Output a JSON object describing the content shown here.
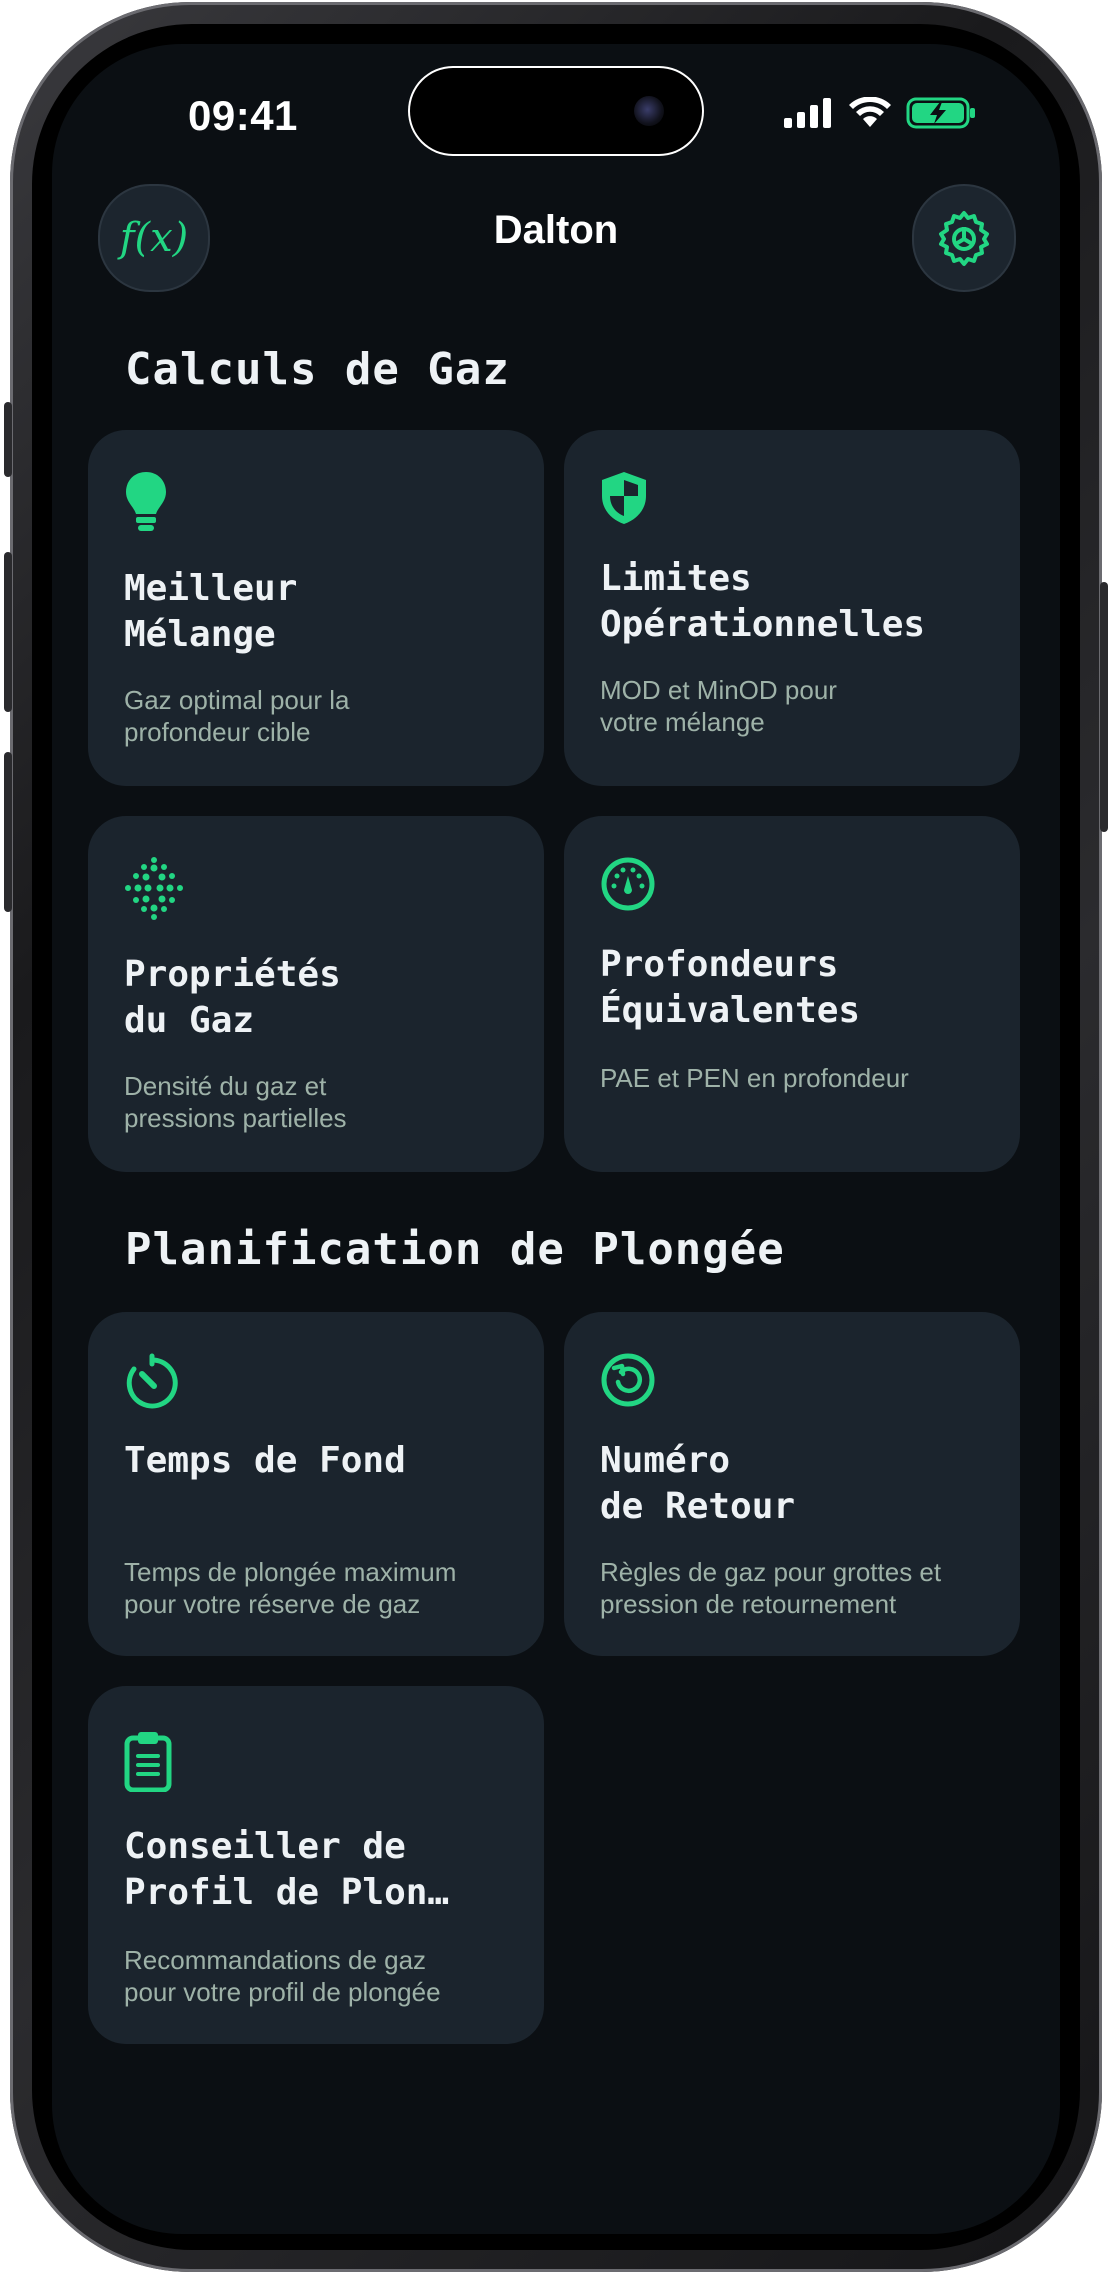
{
  "status_bar": {
    "time": "09:41"
  },
  "nav": {
    "title": "Dalton",
    "left_button_label": "f(x)"
  },
  "sections": [
    {
      "title": "Calculs de Gaz",
      "cards": [
        {
          "title": "Meilleur\nMélange",
          "subtitle": "Gaz optimal pour la\nprofondeur cible",
          "icon": "lightbulb-icon"
        },
        {
          "title": "Limites\nOpérationnelles",
          "subtitle": "MOD et MinOD pour\nvotre mélange",
          "icon": "shield-icon"
        },
        {
          "title": "Propriétés\ndu Gaz",
          "subtitle": "Densité du gaz et\npressions partielles",
          "icon": "dots-icon"
        },
        {
          "title": "Profondeurs\nÉquivalentes",
          "subtitle": "PAE et PEN en profondeur",
          "icon": "gauge-icon"
        }
      ]
    },
    {
      "title": "Planification de Plongée",
      "cards": [
        {
          "title": "Temps de Fond",
          "subtitle": "Temps de plongée maximum\npour votre réserve de gaz",
          "icon": "timer-icon"
        },
        {
          "title": "Numéro\nde Retour",
          "subtitle": "Règles de gaz pour grottes et\npression de retournement",
          "icon": "return-icon"
        },
        {
          "title": "Conseiller de\nProfil de Plon…",
          "subtitle": "Recommandations de gaz\npour votre profil de plongée",
          "icon": "clipboard-icon"
        }
      ]
    }
  ],
  "colors": {
    "accent": "#22d683",
    "background": "#0b0f13",
    "card": "#1b242d",
    "subtitle": "#9eb2a8"
  }
}
